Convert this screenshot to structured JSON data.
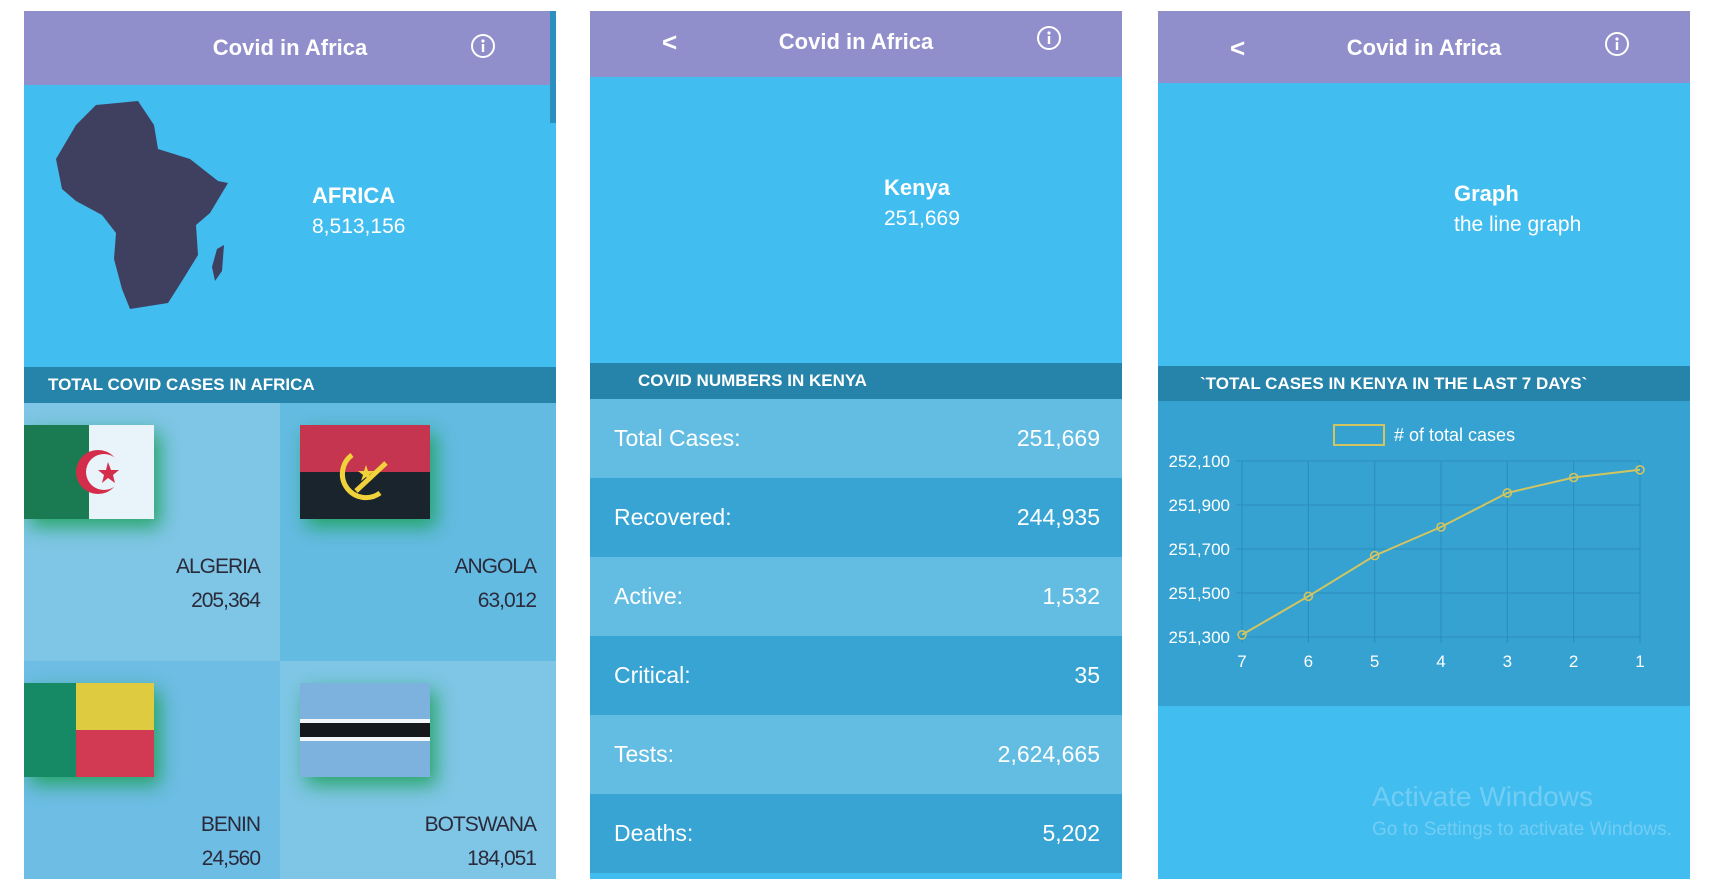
{
  "app_title": "Covid in Africa",
  "back_label": "<",
  "colors": {
    "appbar": "#918ecc",
    "hero": "#42bdf0",
    "section_bar": "#2683a9",
    "africa_map": "#3f3f5f",
    "chart_line": "#d2c560"
  },
  "home": {
    "hero_title": "AFRICA",
    "hero_count": "8,513,156",
    "section_title": "TOTAL COVID CASES IN AFRICA",
    "countries": [
      {
        "name": "ALGERIA",
        "count": "205,364",
        "flag": "algeria-flag"
      },
      {
        "name": "ANGOLA",
        "count": "63,012",
        "flag": "angola-flag"
      },
      {
        "name": "BENIN",
        "count": "24,560",
        "flag": "benin-flag"
      },
      {
        "name": "BOTSWANA",
        "count": "184,051",
        "flag": "botswana-flag"
      }
    ]
  },
  "country": {
    "hero_title": "Kenya",
    "hero_count": "251,669",
    "section_title": "COVID NUMBERS IN KENYA",
    "stats": [
      {
        "label": "Total Cases:",
        "value": "251,669"
      },
      {
        "label": "Recovered:",
        "value": "244,935"
      },
      {
        "label": "Active:",
        "value": "1,532"
      },
      {
        "label": "Critical:",
        "value": "35"
      },
      {
        "label": "Tests:",
        "value": "2,624,665"
      },
      {
        "label": "Deaths:",
        "value": "5,202"
      }
    ]
  },
  "graph": {
    "hero_title": "Graph",
    "hero_subtitle": "the line graph",
    "section_title": "`TOTAL CASES IN KENYA IN THE LAST 7 DAYS`"
  },
  "chart_data": {
    "type": "line",
    "x": [
      "7",
      "6",
      "5",
      "4",
      "3",
      "2",
      "1"
    ],
    "series": [
      {
        "name": "# of total cases",
        "values": [
          251310,
          251485,
          251670,
          251800,
          251955,
          252025,
          252060
        ]
      }
    ],
    "yticks": [
      "252,100",
      "251,900",
      "251,700",
      "251,500",
      "251,300"
    ],
    "ylim": [
      251300,
      252100
    ],
    "grid": true,
    "legend": "top-center"
  },
  "watermark": {
    "title": "Activate Windows",
    "subtitle": "Go to Settings to activate Windows."
  }
}
